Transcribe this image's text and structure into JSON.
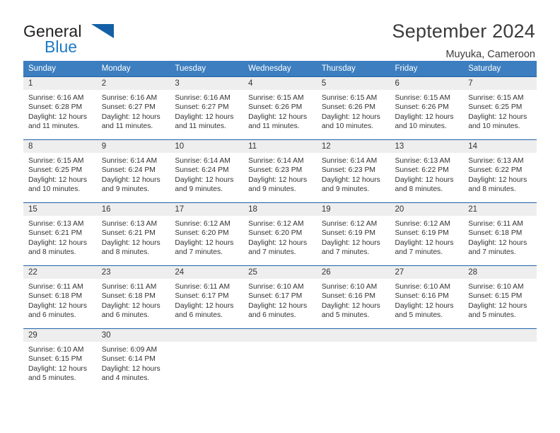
{
  "brand": {
    "name_part1": "General",
    "name_part2": "Blue",
    "logo_icon": "triangle-icon"
  },
  "header": {
    "title": "September 2024",
    "subtitle": "Muyuka, Cameroon"
  },
  "colors": {
    "header_blue": "#3c7ebf",
    "row_divider_blue": "#1f63a8",
    "daynum_bg": "#eeeeee",
    "brand_blue": "#1e7bc4",
    "logo_blue": "#1360a6"
  },
  "calendar": {
    "weekday_headers": [
      "Sunday",
      "Monday",
      "Tuesday",
      "Wednesday",
      "Thursday",
      "Friday",
      "Saturday"
    ],
    "weeks": [
      [
        {
          "day": "1",
          "sunrise": "Sunrise: 6:16 AM",
          "sunset": "Sunset: 6:28 PM",
          "daylight1": "Daylight: 12 hours",
          "daylight2": "and 11 minutes."
        },
        {
          "day": "2",
          "sunrise": "Sunrise: 6:16 AM",
          "sunset": "Sunset: 6:27 PM",
          "daylight1": "Daylight: 12 hours",
          "daylight2": "and 11 minutes."
        },
        {
          "day": "3",
          "sunrise": "Sunrise: 6:16 AM",
          "sunset": "Sunset: 6:27 PM",
          "daylight1": "Daylight: 12 hours",
          "daylight2": "and 11 minutes."
        },
        {
          "day": "4",
          "sunrise": "Sunrise: 6:15 AM",
          "sunset": "Sunset: 6:26 PM",
          "daylight1": "Daylight: 12 hours",
          "daylight2": "and 11 minutes."
        },
        {
          "day": "5",
          "sunrise": "Sunrise: 6:15 AM",
          "sunset": "Sunset: 6:26 PM",
          "daylight1": "Daylight: 12 hours",
          "daylight2": "and 10 minutes."
        },
        {
          "day": "6",
          "sunrise": "Sunrise: 6:15 AM",
          "sunset": "Sunset: 6:26 PM",
          "daylight1": "Daylight: 12 hours",
          "daylight2": "and 10 minutes."
        },
        {
          "day": "7",
          "sunrise": "Sunrise: 6:15 AM",
          "sunset": "Sunset: 6:25 PM",
          "daylight1": "Daylight: 12 hours",
          "daylight2": "and 10 minutes."
        }
      ],
      [
        {
          "day": "8",
          "sunrise": "Sunrise: 6:15 AM",
          "sunset": "Sunset: 6:25 PM",
          "daylight1": "Daylight: 12 hours",
          "daylight2": "and 10 minutes."
        },
        {
          "day": "9",
          "sunrise": "Sunrise: 6:14 AM",
          "sunset": "Sunset: 6:24 PM",
          "daylight1": "Daylight: 12 hours",
          "daylight2": "and 9 minutes."
        },
        {
          "day": "10",
          "sunrise": "Sunrise: 6:14 AM",
          "sunset": "Sunset: 6:24 PM",
          "daylight1": "Daylight: 12 hours",
          "daylight2": "and 9 minutes."
        },
        {
          "day": "11",
          "sunrise": "Sunrise: 6:14 AM",
          "sunset": "Sunset: 6:23 PM",
          "daylight1": "Daylight: 12 hours",
          "daylight2": "and 9 minutes."
        },
        {
          "day": "12",
          "sunrise": "Sunrise: 6:14 AM",
          "sunset": "Sunset: 6:23 PM",
          "daylight1": "Daylight: 12 hours",
          "daylight2": "and 9 minutes."
        },
        {
          "day": "13",
          "sunrise": "Sunrise: 6:13 AM",
          "sunset": "Sunset: 6:22 PM",
          "daylight1": "Daylight: 12 hours",
          "daylight2": "and 8 minutes."
        },
        {
          "day": "14",
          "sunrise": "Sunrise: 6:13 AM",
          "sunset": "Sunset: 6:22 PM",
          "daylight1": "Daylight: 12 hours",
          "daylight2": "and 8 minutes."
        }
      ],
      [
        {
          "day": "15",
          "sunrise": "Sunrise: 6:13 AM",
          "sunset": "Sunset: 6:21 PM",
          "daylight1": "Daylight: 12 hours",
          "daylight2": "and 8 minutes."
        },
        {
          "day": "16",
          "sunrise": "Sunrise: 6:13 AM",
          "sunset": "Sunset: 6:21 PM",
          "daylight1": "Daylight: 12 hours",
          "daylight2": "and 8 minutes."
        },
        {
          "day": "17",
          "sunrise": "Sunrise: 6:12 AM",
          "sunset": "Sunset: 6:20 PM",
          "daylight1": "Daylight: 12 hours",
          "daylight2": "and 7 minutes."
        },
        {
          "day": "18",
          "sunrise": "Sunrise: 6:12 AM",
          "sunset": "Sunset: 6:20 PM",
          "daylight1": "Daylight: 12 hours",
          "daylight2": "and 7 minutes."
        },
        {
          "day": "19",
          "sunrise": "Sunrise: 6:12 AM",
          "sunset": "Sunset: 6:19 PM",
          "daylight1": "Daylight: 12 hours",
          "daylight2": "and 7 minutes."
        },
        {
          "day": "20",
          "sunrise": "Sunrise: 6:12 AM",
          "sunset": "Sunset: 6:19 PM",
          "daylight1": "Daylight: 12 hours",
          "daylight2": "and 7 minutes."
        },
        {
          "day": "21",
          "sunrise": "Sunrise: 6:11 AM",
          "sunset": "Sunset: 6:18 PM",
          "daylight1": "Daylight: 12 hours",
          "daylight2": "and 7 minutes."
        }
      ],
      [
        {
          "day": "22",
          "sunrise": "Sunrise: 6:11 AM",
          "sunset": "Sunset: 6:18 PM",
          "daylight1": "Daylight: 12 hours",
          "daylight2": "and 6 minutes."
        },
        {
          "day": "23",
          "sunrise": "Sunrise: 6:11 AM",
          "sunset": "Sunset: 6:18 PM",
          "daylight1": "Daylight: 12 hours",
          "daylight2": "and 6 minutes."
        },
        {
          "day": "24",
          "sunrise": "Sunrise: 6:11 AM",
          "sunset": "Sunset: 6:17 PM",
          "daylight1": "Daylight: 12 hours",
          "daylight2": "and 6 minutes."
        },
        {
          "day": "25",
          "sunrise": "Sunrise: 6:10 AM",
          "sunset": "Sunset: 6:17 PM",
          "daylight1": "Daylight: 12 hours",
          "daylight2": "and 6 minutes."
        },
        {
          "day": "26",
          "sunrise": "Sunrise: 6:10 AM",
          "sunset": "Sunset: 6:16 PM",
          "daylight1": "Daylight: 12 hours",
          "daylight2": "and 5 minutes."
        },
        {
          "day": "27",
          "sunrise": "Sunrise: 6:10 AM",
          "sunset": "Sunset: 6:16 PM",
          "daylight1": "Daylight: 12 hours",
          "daylight2": "and 5 minutes."
        },
        {
          "day": "28",
          "sunrise": "Sunrise: 6:10 AM",
          "sunset": "Sunset: 6:15 PM",
          "daylight1": "Daylight: 12 hours",
          "daylight2": "and 5 minutes."
        }
      ],
      [
        {
          "day": "29",
          "sunrise": "Sunrise: 6:10 AM",
          "sunset": "Sunset: 6:15 PM",
          "daylight1": "Daylight: 12 hours",
          "daylight2": "and 5 minutes."
        },
        {
          "day": "30",
          "sunrise": "Sunrise: 6:09 AM",
          "sunset": "Sunset: 6:14 PM",
          "daylight1": "Daylight: 12 hours",
          "daylight2": "and 4 minutes."
        },
        {
          "day": "",
          "sunrise": "",
          "sunset": "",
          "daylight1": "",
          "daylight2": ""
        },
        {
          "day": "",
          "sunrise": "",
          "sunset": "",
          "daylight1": "",
          "daylight2": ""
        },
        {
          "day": "",
          "sunrise": "",
          "sunset": "",
          "daylight1": "",
          "daylight2": ""
        },
        {
          "day": "",
          "sunrise": "",
          "sunset": "",
          "daylight1": "",
          "daylight2": ""
        },
        {
          "day": "",
          "sunrise": "",
          "sunset": "",
          "daylight1": "",
          "daylight2": ""
        }
      ]
    ]
  }
}
